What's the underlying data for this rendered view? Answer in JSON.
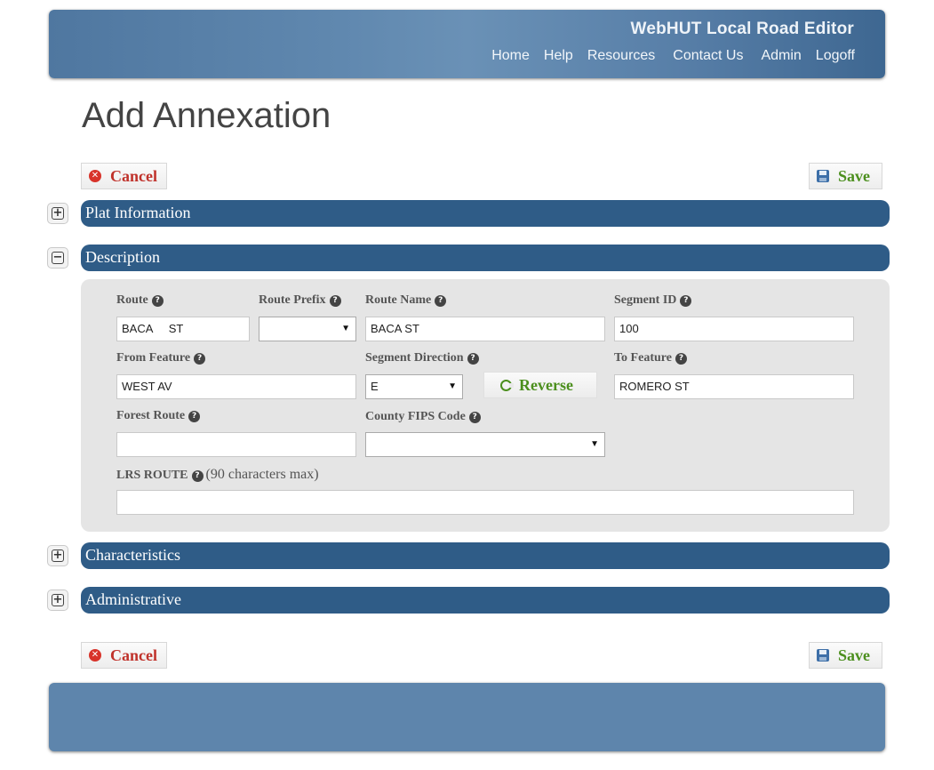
{
  "header": {
    "app_title": "WebHUT Local Road Editor",
    "nav": [
      "Home",
      "Help",
      "Resources",
      "Contact Us",
      "Admin",
      "Logoff"
    ]
  },
  "page_title": "Add Annexation",
  "actions": {
    "cancel_label": "Cancel",
    "save_label": "Save"
  },
  "sections": {
    "plat": "Plat Information",
    "description": "Description",
    "characteristics": "Characteristics",
    "administrative": "Administrative"
  },
  "toggles": {
    "expand": "+",
    "collapse": "−"
  },
  "form": {
    "route": {
      "label": "Route",
      "value": "BACA     ST"
    },
    "route_prefix": {
      "label": "Route Prefix",
      "value": ""
    },
    "route_name": {
      "label": "Route Name",
      "value": "BACA ST"
    },
    "segment_id": {
      "label": "Segment ID",
      "value": "100"
    },
    "from_feature": {
      "label": "From Feature",
      "value": "WEST AV"
    },
    "segment_direction": {
      "label": "Segment Direction",
      "value": "E"
    },
    "reverse_label": "Reverse",
    "to_feature": {
      "label": "To Feature",
      "value": "ROMERO ST"
    },
    "forest_route": {
      "label": "Forest Route",
      "value": ""
    },
    "county_fips": {
      "label": "County FIPS Code",
      "value": ""
    },
    "lrs_route": {
      "label": "LRS ROUTE",
      "note": "(90 characters max)",
      "value": ""
    }
  },
  "icons": {
    "help": "?",
    "dropdown": "▼"
  }
}
